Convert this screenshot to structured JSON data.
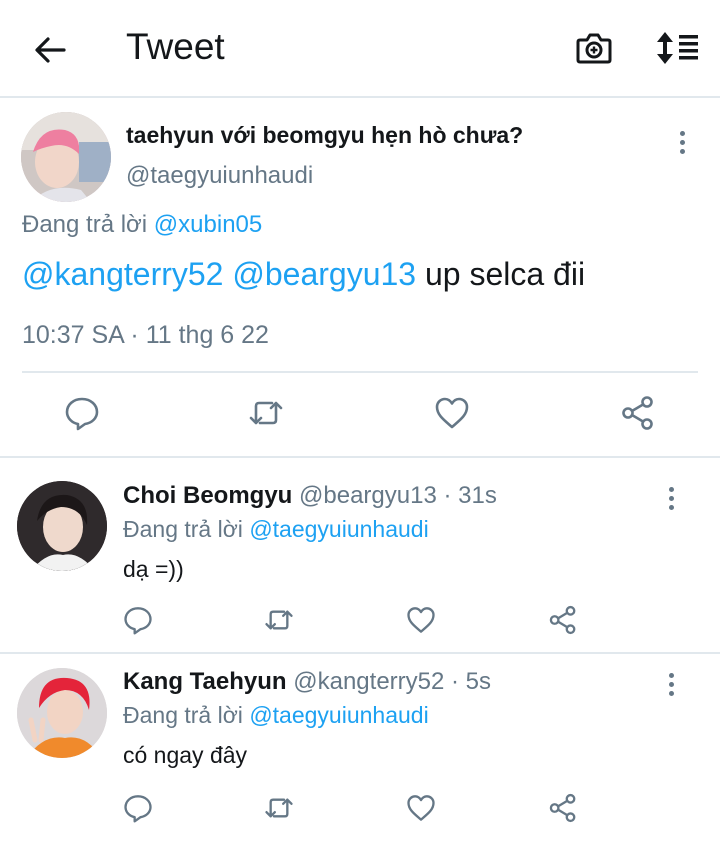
{
  "header": {
    "title": "Tweet",
    "icons": [
      "back-arrow-icon",
      "camera-add-icon",
      "sort-icon"
    ]
  },
  "main_tweet": {
    "display_name": "taehyun với beomgyu hẹn hò chưa?",
    "handle": "@taegyuiunhaudi",
    "replying_prefix": "Đang trả lời ",
    "replying_to": "@xubin05",
    "mention_1": "@kangterry52",
    "mention_2": "@beargyu13",
    "text": " up selca đii",
    "timestamp": "10:37 SA · 11 thg 6 22"
  },
  "replies": [
    {
      "display_name": "Choi Beomgyu",
      "handle_time": " @beargyu13 · 31s",
      "replying_prefix": "Đang trả lời ",
      "replying_to": "@taegyuiunhaudi",
      "text": "dạ =))"
    },
    {
      "display_name": "Kang Taehyun",
      "handle_time": " @kangterry52 · 5s",
      "replying_prefix": "Đang trả lời ",
      "replying_to": "@taegyuiunhaudi",
      "text": "có ngay đây"
    }
  ],
  "colors": {
    "link": "#1da1f2",
    "secondary_text": "#657786",
    "divider": "#e1e8ed",
    "icon": "#657786"
  }
}
